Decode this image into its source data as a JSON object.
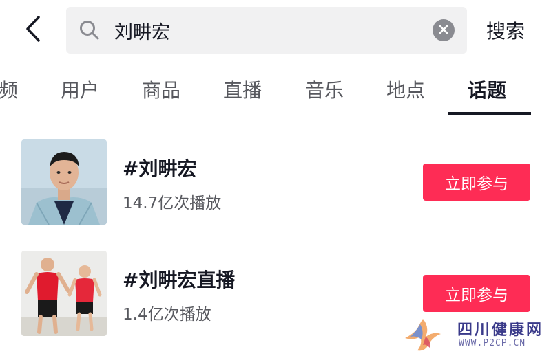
{
  "header": {
    "back_icon": "chevron-left-icon",
    "search_icon": "search-icon",
    "search_query": "刘畊宏",
    "clear_icon": "close-circle-icon",
    "search_action_label": "搜索"
  },
  "tabs": [
    {
      "label": "频",
      "active": false
    },
    {
      "label": "用户",
      "active": false
    },
    {
      "label": "商品",
      "active": false
    },
    {
      "label": "直播",
      "active": false
    },
    {
      "label": "音乐",
      "active": false
    },
    {
      "label": "地点",
      "active": false
    },
    {
      "label": "话题",
      "active": true
    }
  ],
  "results": [
    {
      "title": "#刘畊宏",
      "plays": "14.7亿次播放",
      "button_label": "立即参与"
    },
    {
      "title": "#刘畊宏直播",
      "plays": "1.4亿次播放",
      "button_label": "立即参与"
    }
  ],
  "watermark": {
    "name": "四川健康网",
    "url": "WWW.P2CP.CN"
  },
  "colors": {
    "accent": "#fe2c55",
    "text_primary": "#161823",
    "text_secondary": "#57585e",
    "search_bg": "#f1f1f2"
  }
}
